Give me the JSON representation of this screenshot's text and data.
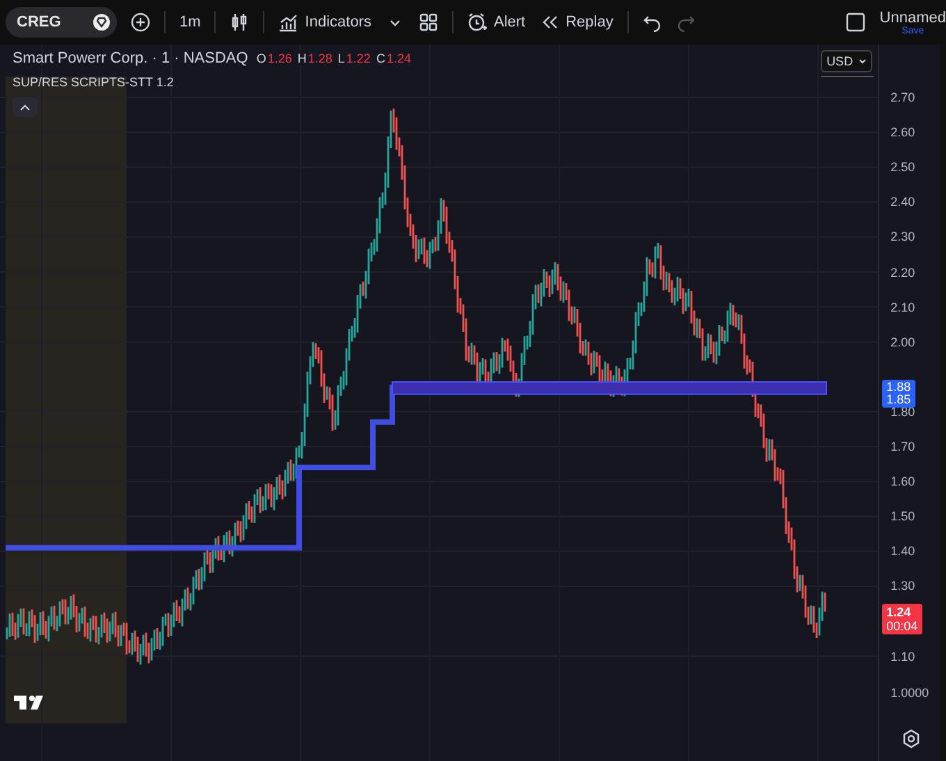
{
  "toolbar": {
    "symbol": "CREG",
    "interval": "1m",
    "indicators": "Indicators",
    "alert": "Alert",
    "replay": "Replay",
    "layout_name": "Unnamed",
    "save": "Save"
  },
  "legend": {
    "title": "Smart Powerr Corp. · 1 · NASDAQ",
    "ohlc": [
      {
        "label": "O",
        "value": "1.26"
      },
      {
        "label": "H",
        "value": "1.28"
      },
      {
        "label": "L",
        "value": "1.22"
      },
      {
        "label": "C",
        "value": "1.24"
      }
    ],
    "indicator": "SUP/RES SCRIPTS-STT 1.2"
  },
  "currency": "USD",
  "price_axis": [
    "2.70",
    "2.60",
    "2.50",
    "2.40",
    "2.30",
    "2.20",
    "2.10",
    "2.00",
    "1.80",
    "1.70",
    "1.60",
    "1.50",
    "1.40",
    "1.30",
    "1.10",
    "1.0000"
  ],
  "level_label": {
    "upper": "1.88",
    "lower": "1.85"
  },
  "last_price": {
    "price": "1.24",
    "countdown": "00:04"
  }
}
